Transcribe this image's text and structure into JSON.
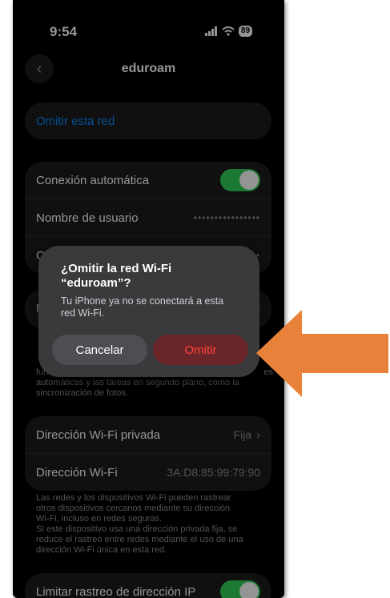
{
  "status_bar": {
    "time": "9:54",
    "battery": "89"
  },
  "nav": {
    "title": "eduroam"
  },
  "network": {
    "forget_label": "Omitir esta red",
    "auto_join_label": "Conexión automática",
    "auto_join_on": true,
    "username_label": "Nombre de usuario",
    "username_value": "••••••••••••••••",
    "password_label_partial": "Co",
    "password_value_partial": "••",
    "low_data_label_partial": "M",
    "low_data_footer_partial": "fun",
    "low_data_footer_tail": "es",
    "low_data_footer_line2": "automáticas y las tareas en segundo plano, como la",
    "low_data_footer_line3": "sincronización de fotos."
  },
  "privacy": {
    "private_address_label": "Dirección Wi-Fi privada",
    "private_address_value": "Fija",
    "wifi_address_label": "Dirección Wi-Fi",
    "wifi_address_value": "3A:D8:85:99:79:90",
    "footer_lines": [
      "Las redes y los dispositivos Wi-Fi pueden rastrear",
      "otros dispositivos cercanos mediante su dirección",
      "Wi-Fi, incluso en redes seguras.",
      "Si este dispositivo usa una dirección privada fija, se",
      "reduce el rastreo entre redes mediante el uso de una",
      "dirección Wi-Fi única en esta red."
    ],
    "limit_ip_label": "Limitar rastreo de dirección IP",
    "limit_ip_on": true
  },
  "alert": {
    "title_line1": "¿Omitir la red Wi-Fi",
    "title_line2": "“eduroam”?",
    "message_line1": "Tu iPhone ya no se conectará a esta",
    "message_line2": "red Wi-Fi.",
    "cancel_label": "Cancelar",
    "confirm_label": "Omitir"
  },
  "colors": {
    "accent_blue": "#0a84ff",
    "toggle_green": "#30d158",
    "destructive_red": "#ff453a",
    "annotation_arrow": "#e8823a"
  },
  "icons": [
    "back-chevron-icon",
    "signal-icon",
    "wifi-icon",
    "battery-icon",
    "annotation-arrow-icon"
  ]
}
